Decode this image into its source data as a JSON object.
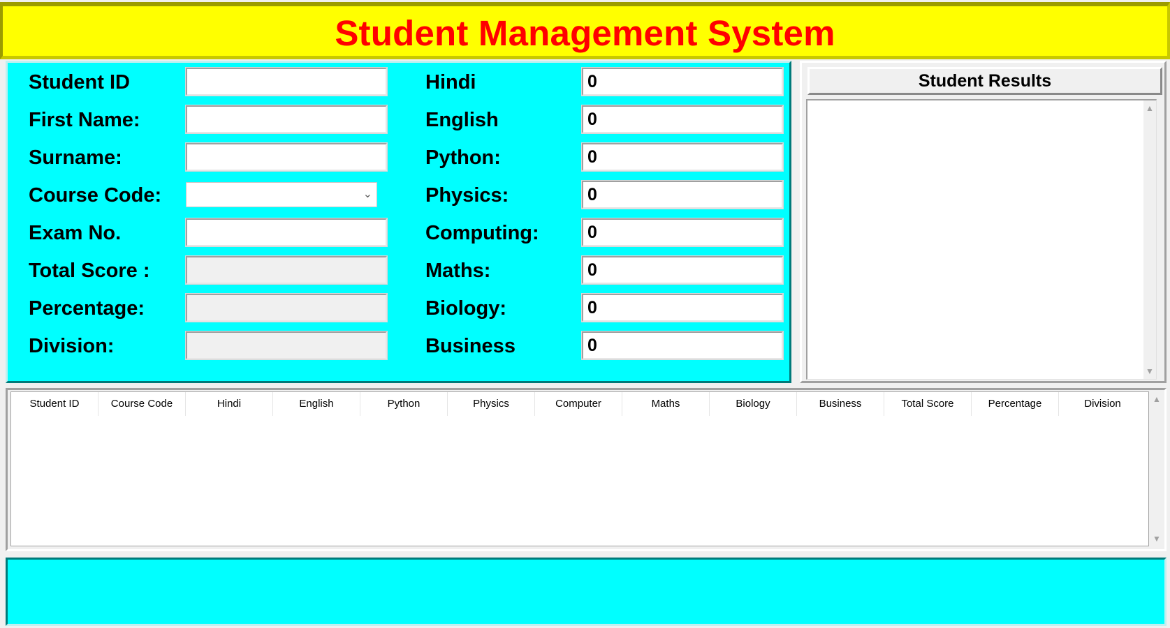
{
  "title": "Student Management System",
  "colors": {
    "title_bg": "#ffff00",
    "title_text": "#ff0000",
    "panel_bg": "#00ffff"
  },
  "form": {
    "left_fields": [
      {
        "label": "Student ID",
        "value": ""
      },
      {
        "label": "First Name:",
        "value": ""
      },
      {
        "label": "Surname:",
        "value": ""
      },
      {
        "label": "Course Code:",
        "value": ""
      },
      {
        "label": "Exam No.",
        "value": ""
      },
      {
        "label": "Total Score :",
        "value": ""
      },
      {
        "label": "Percentage:",
        "value": ""
      },
      {
        "label": "Division:",
        "value": ""
      }
    ],
    "subjects": [
      {
        "label": "Hindi",
        "value": "0"
      },
      {
        "label": "English",
        "value": "0"
      },
      {
        "label": "Python:",
        "value": "0"
      },
      {
        "label": "Physics:",
        "value": "0"
      },
      {
        "label": "Computing:",
        "value": "0"
      },
      {
        "label": "Maths:",
        "value": "0"
      },
      {
        "label": "Biology:",
        "value": "0"
      },
      {
        "label": "Business",
        "value": "0"
      }
    ]
  },
  "results": {
    "button_label": "Student Results",
    "text": ""
  },
  "table": {
    "columns": [
      "Student ID",
      "Course Code",
      "Hindi",
      "English",
      "Python",
      "Physics",
      "Computer",
      "Maths",
      "Biology",
      "Business",
      "Total Score",
      "Percentage",
      "Division"
    ],
    "rows": []
  }
}
